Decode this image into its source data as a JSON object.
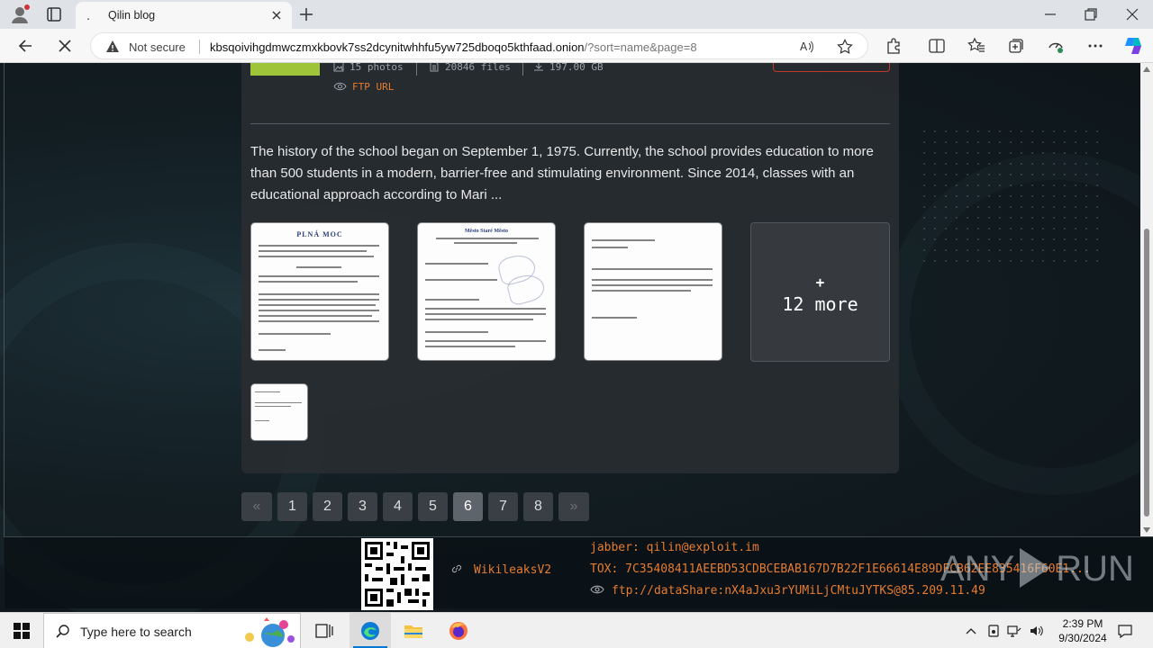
{
  "browser": {
    "tab_title": "Qilin blog",
    "tab_favicon": ".",
    "security_label": "Not secure",
    "url_host": "kbsqoivihgdmwczmxkbovk7ss2dcynitwhhfu5yw725dboqo5kthfaad.onion",
    "url_rest": "/?sort=name&page=8"
  },
  "post": {
    "photos": "15 photos",
    "files": "20846 files",
    "size": "197.00 GB",
    "ftp_label": "FTP URL",
    "description": "The history of the school began on September 1, 1975. Currently, the school provides education to more than 500 students in a modern, barrier-free and stimulating environment. Since 2014, classes with an educational approach according to Mari ...",
    "thumb1_heading": "PLNÁ MOC",
    "thumb2_heading": "Město Staré Město",
    "more_plus": "+",
    "more_label": "12 more"
  },
  "pagination": {
    "prev": "«",
    "pages": [
      "1",
      "2",
      "3",
      "4",
      "5",
      "6",
      "7",
      "8"
    ],
    "active_page": "6",
    "next": "»"
  },
  "footer": {
    "link_label": "WikileaksV2",
    "jabber": "jabber: qilin@exploit.im",
    "tox": "TOX: 7C35408411AEEBD53CDBCEBAB167D7B22F1E66614E89DFCB62EE835416F60E1...",
    "ftp": "ftp://dataShare:nX4aJxu3rYUMiLjCMtuJYTKS@85.209.11.49"
  },
  "watermark": {
    "brand": "ANY",
    "brand2": "RUN"
  },
  "taskbar": {
    "search_placeholder": "Type here to search",
    "time": "2:39 PM",
    "date": "9/30/2024"
  },
  "colors": {
    "accent_orange": "#e57c2f",
    "tag_green": "#9ec53a",
    "button_red": "#c0392b",
    "edge_blue": "#0078d4"
  },
  "icons": [
    "profile-icon",
    "tabs-icon",
    "close-icon",
    "plus-icon",
    "minimize-icon",
    "restore-icon",
    "back-icon",
    "stop-icon",
    "warning-icon",
    "read-aloud-icon",
    "star-icon",
    "extensions-icon",
    "split-screen-icon",
    "favorites-icon",
    "collections-icon",
    "performance-icon",
    "more-icon",
    "copilot-icon",
    "image-icon",
    "file-icon",
    "download-icon",
    "eye-icon",
    "link-icon",
    "windows-start-icon",
    "search-icon",
    "task-view-icon",
    "edge-icon",
    "file-explorer-icon",
    "firefox-icon",
    "chevron-up-icon",
    "network-icon",
    "volume-icon",
    "notification-icon"
  ]
}
